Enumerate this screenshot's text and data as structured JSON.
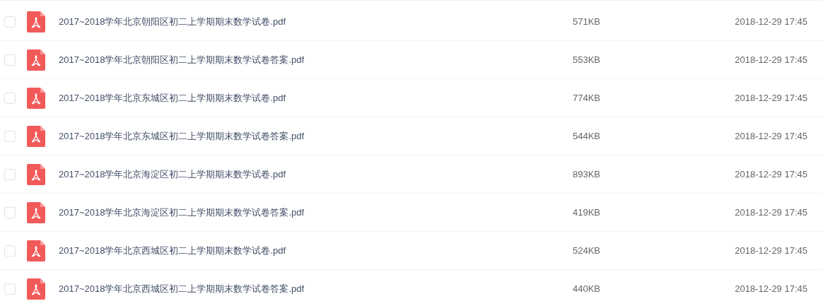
{
  "files": [
    {
      "name": "2017~2018学年北京朝阳区初二上学期期末数学试卷.pdf",
      "size": "571KB",
      "date": "2018-12-29 17:45",
      "checked": false
    },
    {
      "name": "2017~2018学年北京朝阳区初二上学期期末数学试卷答案.pdf",
      "size": "553KB",
      "date": "2018-12-29 17:45",
      "checked": false
    },
    {
      "name": "2017~2018学年北京东城区初二上学期期末数学试卷.pdf",
      "size": "774KB",
      "date": "2018-12-29 17:45",
      "checked": false
    },
    {
      "name": "2017~2018学年北京东城区初二上学期期末数学试卷答案.pdf",
      "size": "544KB",
      "date": "2018-12-29 17:45",
      "checked": false
    },
    {
      "name": "2017~2018学年北京海淀区初二上学期期末数学试卷.pdf",
      "size": "893KB",
      "date": "2018-12-29 17:45",
      "checked": false
    },
    {
      "name": "2017~2018学年北京海淀区初二上学期期末数学试卷答案.pdf",
      "size": "419KB",
      "date": "2018-12-29 17:45",
      "checked": false
    },
    {
      "name": "2017~2018学年北京西城区初二上学期期末数学试卷.pdf",
      "size": "524KB",
      "date": "2018-12-29 17:45",
      "checked": false
    },
    {
      "name": "2017~2018学年北京西城区初二上学期期末数学试卷答案.pdf",
      "size": "440KB",
      "date": "2018-12-29 17:45",
      "checked": false
    }
  ]
}
